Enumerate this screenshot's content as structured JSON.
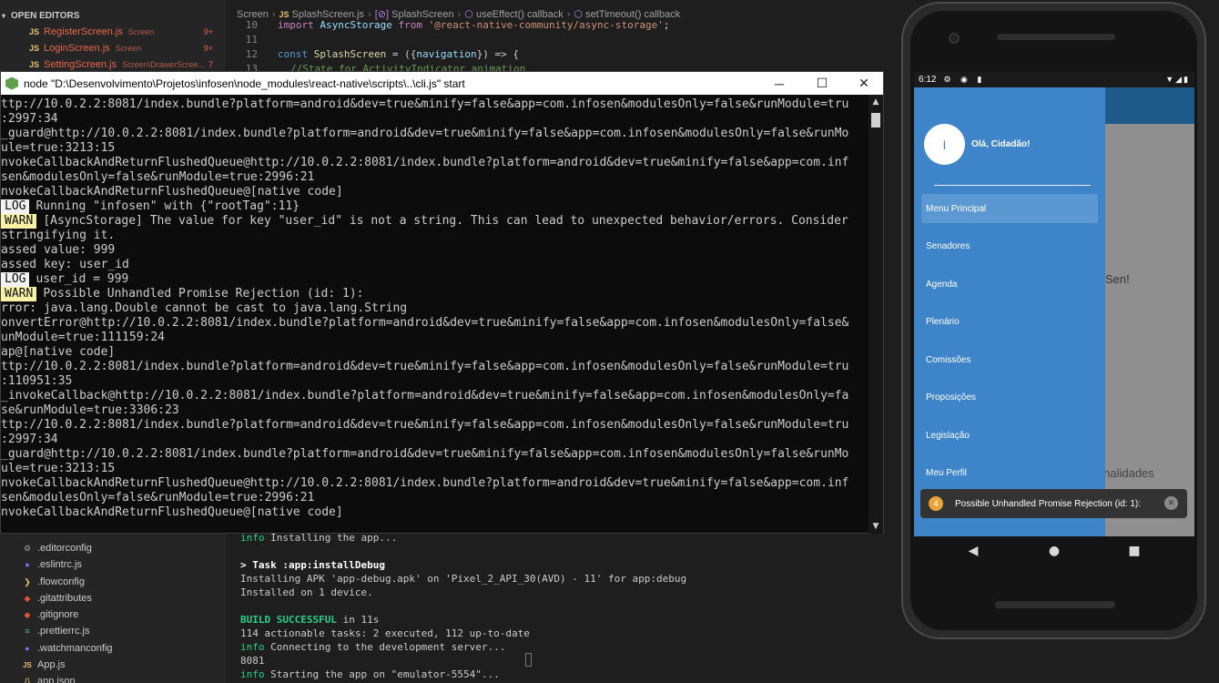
{
  "open_editors": {
    "header": "OPEN EDITORS",
    "items": [
      {
        "icon": "JS",
        "name": "RegisterScreen.js",
        "dir": "Screen",
        "count": "9+"
      },
      {
        "icon": "JS",
        "name": "LoginScreen.js",
        "dir": "Screen",
        "count": "9+"
      },
      {
        "icon": "JS",
        "name": "SettingScreen.js",
        "dir": "Screen\\DrawerScree...",
        "count": "7"
      }
    ]
  },
  "explorer_files": [
    {
      "name": ".editorconfig",
      "icon": "gear-icon"
    },
    {
      "name": ".eslintrc.js",
      "icon": "eslint-icon"
    },
    {
      "name": ".flowconfig",
      "icon": "flow-icon"
    },
    {
      "name": ".gitattributes",
      "icon": "git-icon"
    },
    {
      "name": ".gitignore",
      "icon": "git-icon"
    },
    {
      "name": ".prettierrc.js",
      "icon": "prettier-icon"
    },
    {
      "name": ".watchmanconfig",
      "icon": "watchman-icon"
    },
    {
      "name": "App.js",
      "icon": "js-icon"
    },
    {
      "name": "app.json",
      "icon": "json-icon"
    }
  ],
  "breadcrumb": {
    "parts": [
      "Screen",
      "SplashScreen.js",
      "SplashScreen",
      "useEffect() callback",
      "setTimeout() callback"
    ],
    "js_badge": "JS"
  },
  "code": {
    "lines": [
      {
        "num": "10",
        "a": "import ",
        "b": "AsyncStorage",
        "c": " from ",
        "d": "'@react-native-community/async-storage'",
        "e": ";"
      },
      {
        "num": "11",
        "text": ""
      },
      {
        "num": "12",
        "a": "const ",
        "b": "SplashScreen",
        "c": " = ({",
        "d": "navigation",
        "e": "}) => {"
      },
      {
        "num": "13",
        "text": "//State for ActivityIndicator animation"
      }
    ]
  },
  "console": {
    "title": "node  \"D:\\Desenvolvimento\\Projetos\\infosen\\node_modules\\react-native\\scripts\\..\\cli.js\" start",
    "lines": [
      {
        "text": "ttp://10.0.2.2:8081/index.bundle?platform=android&dev=true&minify=false&app=com.infosen&modulesOnly=false&runModule=tru"
      },
      {
        "text": ":2997:34"
      },
      {
        "text": "_guard@http://10.0.2.2:8081/index.bundle?platform=android&dev=true&minify=false&app=com.infosen&modulesOnly=false&runMo"
      },
      {
        "text": "ule=true:3213:15"
      },
      {
        "text": "nvokeCallbackAndReturnFlushedQueue@http://10.0.2.2:8081/index.bundle?platform=android&dev=true&minify=false&app=com.inf"
      },
      {
        "text": "sen&modulesOnly=false&runModule=true:2996:21"
      },
      {
        "text": "nvokeCallbackAndReturnFlushedQueue@[native code]"
      },
      {
        "tag": "LOG",
        "text": "Running \"infosen\" with {\"rootTag\":11}"
      },
      {
        "tag": "WARN",
        "text": "[AsyncStorage] The value for key \"user_id\" is not a string. This can lead to unexpected behavior/errors. Consider"
      },
      {
        "text": "stringifying it."
      },
      {
        "text": "assed value: 999"
      },
      {
        "text": "assed key: user_id"
      },
      {
        "tag": "LOG",
        "text": "user_id = 999"
      },
      {
        "tag": "WARN",
        "text": "Possible Unhandled Promise Rejection (id: 1):"
      },
      {
        "text": "rror: java.lang.Double cannot be cast to java.lang.String"
      },
      {
        "text": "onvertError@http://10.0.2.2:8081/index.bundle?platform=android&dev=true&minify=false&app=com.infosen&modulesOnly=false&"
      },
      {
        "text": "unModule=true:111159:24"
      },
      {
        "text": "ap@[native code]"
      },
      {
        "text": "ttp://10.0.2.2:8081/index.bundle?platform=android&dev=true&minify=false&app=com.infosen&modulesOnly=false&runModule=tru"
      },
      {
        "text": ":110951:35"
      },
      {
        "text": "_invokeCallback@http://10.0.2.2:8081/index.bundle?platform=android&dev=true&minify=false&app=com.infosen&modulesOnly=fa"
      },
      {
        "text": "se&runModule=true:3306:23"
      },
      {
        "text": "ttp://10.0.2.2:8081/index.bundle?platform=android&dev=true&minify=false&app=com.infosen&modulesOnly=false&runModule=tru"
      },
      {
        "text": ":2997:34"
      },
      {
        "text": "_guard@http://10.0.2.2:8081/index.bundle?platform=android&dev=true&minify=false&app=com.infosen&modulesOnly=false&runMo"
      },
      {
        "text": "ule=true:3213:15"
      },
      {
        "text": "nvokeCallbackAndReturnFlushedQueue@http://10.0.2.2:8081/index.bundle?platform=android&dev=true&minify=false&app=com.inf"
      },
      {
        "text": "sen&modulesOnly=false&runModule=true:2996:21"
      },
      {
        "text": "nvokeCallbackAndReturnFlushedQueue@[native code]"
      }
    ]
  },
  "terminal": {
    "lines": [
      {
        "prefix": "info",
        "text": " Installing the app..."
      },
      {
        "text": ""
      },
      {
        "bold": "> Task :app:installDebug"
      },
      {
        "text": "Installing APK 'app-debug.apk' on 'Pixel_2_API_30(AVD) - 11' for app:debug"
      },
      {
        "text": "Installed on 1 device."
      },
      {
        "text": ""
      },
      {
        "ok": "BUILD SUCCESSFUL",
        "text": " in 11s"
      },
      {
        "text": "114 actionable tasks: 2 executed, 112 up-to-date"
      },
      {
        "prefix": "info",
        "text": " Connecting to the development server..."
      },
      {
        "text": "8081"
      },
      {
        "prefix": "info",
        "text": " Starting the app on \"emulator-5554\"..."
      }
    ]
  },
  "phone": {
    "status_time": "6:12",
    "avatar_letter": "I",
    "greeting": "Olá, Cidadão!",
    "menu": [
      "Menu Principal",
      "Senadores",
      "Agenda",
      "Plenário",
      "Comissões",
      "Proposições",
      "Legislação",
      "Meu Perfil"
    ],
    "background_text_1": "Sen!",
    "background_text_2": "ionalidades",
    "toast": {
      "badge": "4",
      "message": "Possible Unhandled Promise Rejection (id: 1):"
    }
  },
  "colors": {
    "drawer": "#3d84c8",
    "warn_tag": "#f9f1a5",
    "log_tag": "#f2f2f2",
    "info_green": "#23d18b"
  }
}
